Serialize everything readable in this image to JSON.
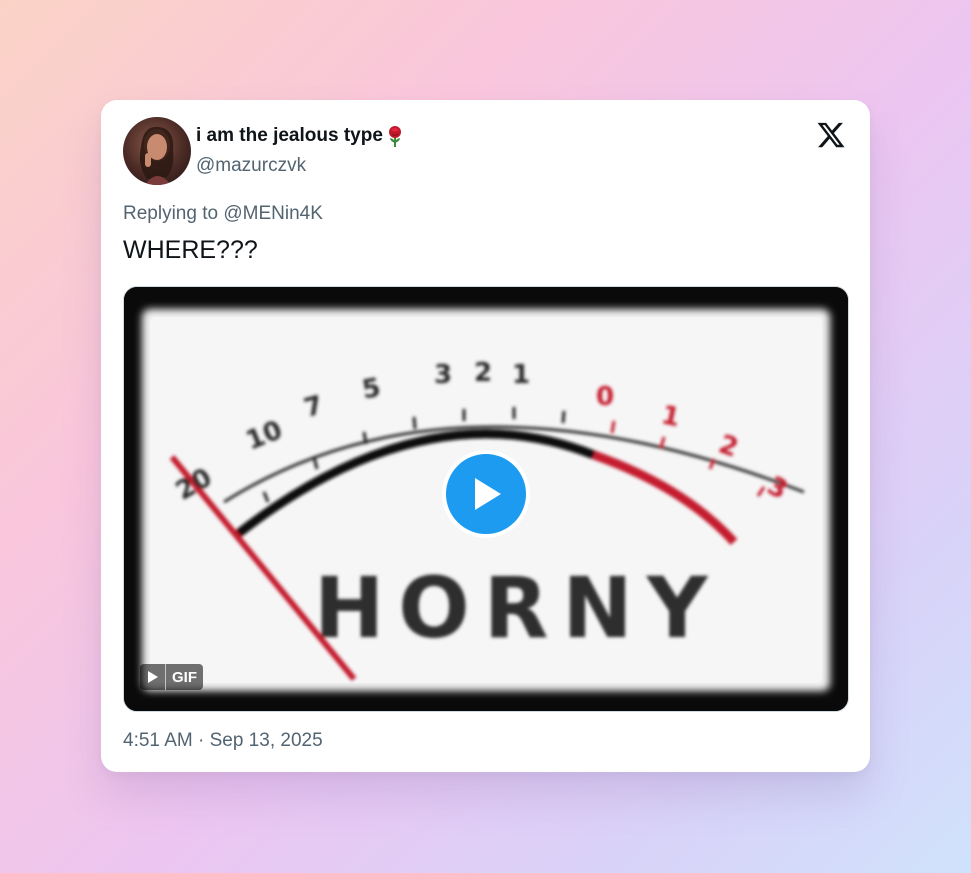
{
  "tweet": {
    "display_name": "i am the jealous type",
    "name_emoji": "rose-emoji",
    "handle": "@mazurczvk",
    "replying_prefix": "Replying to ",
    "replying_to": "@MENin4K",
    "text": "WHERE???",
    "timestamp": "4:51 AM · Sep 13, 2025"
  },
  "media": {
    "type": "gif",
    "badge_label": "GIF",
    "gif_text": "HORNY",
    "dial_numbers": [
      "20",
      "10",
      "7",
      "5",
      "3",
      "2",
      "1",
      "0",
      "1",
      "2",
      "3"
    ],
    "play_button_color": "#1d9bf0"
  },
  "icons": {
    "platform_logo": "x-logo-icon",
    "play": "play-icon"
  },
  "colors": {
    "primary_text": "#0f1419",
    "secondary_text": "#536471",
    "accent": "#1d9bf0"
  }
}
